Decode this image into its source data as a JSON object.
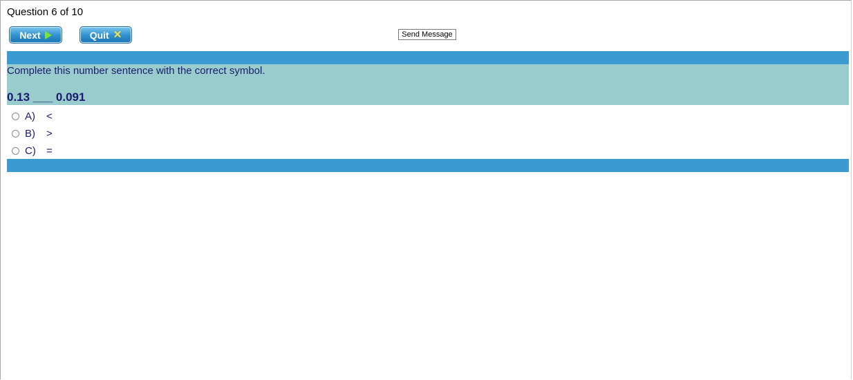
{
  "header": {
    "question_counter": "Question 6 of 10",
    "next_label": "Next",
    "quit_label": "Quit",
    "send_message_label": "Send Message"
  },
  "question": {
    "prompt": "Complete this number sentence with the correct symbol.",
    "expression": "0.13 ___ 0.091"
  },
  "choices": [
    {
      "letter": "A)",
      "symbol": "<"
    },
    {
      "letter": "B)",
      "symbol": ">"
    },
    {
      "letter": "C)",
      "symbol": "="
    }
  ],
  "colors": {
    "bar": "#3b9ad0",
    "question_panel": "#99cdcd",
    "text": "#1a1a6e"
  }
}
